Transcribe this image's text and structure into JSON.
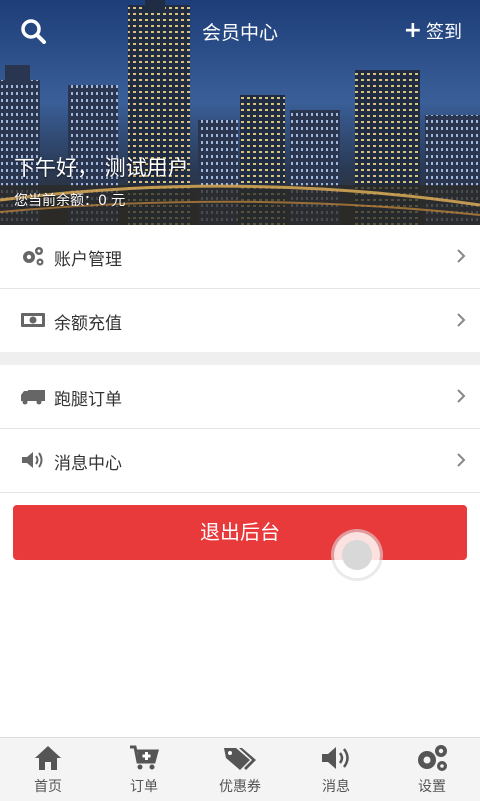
{
  "header": {
    "title": "会员中心",
    "signin_label": "签到",
    "greeting": "下午好， 测试用户",
    "balance_text": "您当前余额：0 元"
  },
  "menu": {
    "items": [
      {
        "label": "账户管理",
        "icon": "gears-icon"
      },
      {
        "label": "余额充值",
        "icon": "money-icon"
      },
      {
        "label": "跑腿订单",
        "icon": "truck-icon"
      },
      {
        "label": "消息中心",
        "icon": "speaker-icon"
      }
    ]
  },
  "logout_label": "退出后台",
  "bottom_nav": [
    {
      "label": "首页",
      "icon": "home-icon"
    },
    {
      "label": "订单",
      "icon": "cart-icon"
    },
    {
      "label": "优惠券",
      "icon": "tags-icon"
    },
    {
      "label": "消息",
      "icon": "speaker-icon"
    },
    {
      "label": "设置",
      "icon": "gears-icon"
    }
  ],
  "colors": {
    "accent": "#e8393b",
    "nav_bg": "#f4f4f4",
    "icon_gray": "#555555"
  }
}
